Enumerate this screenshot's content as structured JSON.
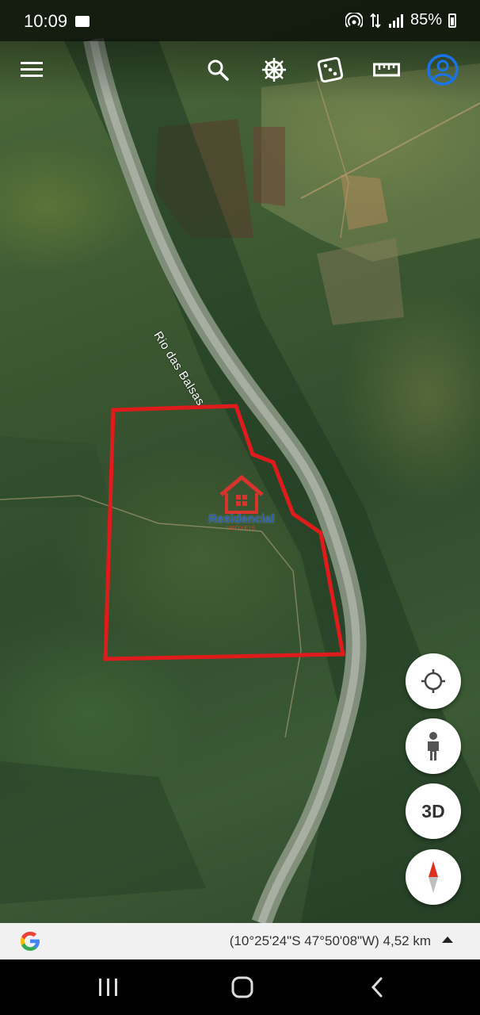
{
  "status_bar": {
    "time": "10:09",
    "battery": "85%",
    "icons": [
      "hotspot-icon",
      "data-transfer-icon",
      "signal-icon",
      "battery-icon"
    ]
  },
  "toolbar": {
    "icons": [
      "menu-icon",
      "search-icon",
      "voyager-wheel-icon",
      "feeling-lucky-dice-icon",
      "measure-ruler-icon",
      "account-icon"
    ],
    "accent_color": "#1a73e8"
  },
  "map": {
    "river_label": "Rio das Balsas",
    "brand_name": "Residencial",
    "brand_sub": "IMÓVEIS",
    "boundary_color": "#e01b1b",
    "brand_color": "#2b5fb0"
  },
  "controls": {
    "location_icon": "my-location-icon",
    "street_view_icon": "pegman-icon",
    "three_d_label": "3D",
    "compass_icon": "compass-icon"
  },
  "info_bar": {
    "coordinates": "(10°25'24\"S 47°50'08\"W) 4,52 km"
  },
  "nav_bar": {
    "icons": [
      "recent-apps-icon",
      "home-icon",
      "back-icon"
    ]
  }
}
